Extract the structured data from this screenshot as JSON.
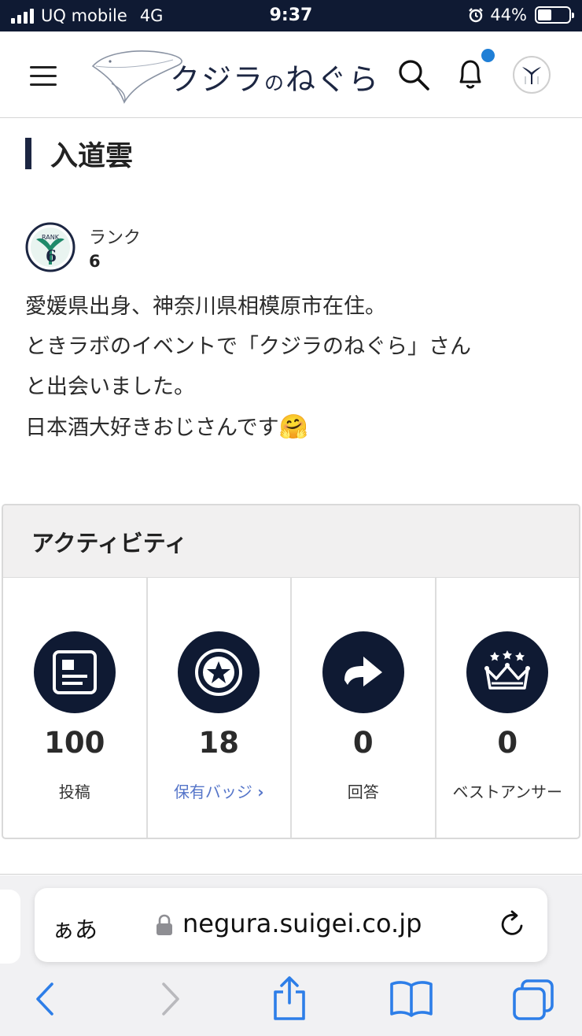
{
  "status_bar": {
    "carrier": "UQ mobile",
    "network": "4G",
    "time": "9:37",
    "battery": "44%",
    "battery_level": 0.44
  },
  "header": {
    "logo_text_main": "クジラ",
    "logo_text_particle": "の",
    "logo_text_tail": "ねぐら",
    "icons": [
      "menu-icon",
      "search-icon",
      "bell-icon",
      "avatar"
    ]
  },
  "profile": {
    "name": "入道雲",
    "rank_label": "ランク",
    "rank_value": "6",
    "rank_badge_text": "RANK",
    "bio_lines": [
      "愛媛県出身、神奈川県相模原市在住。",
      "ときラボのイベントで「クジラのねぐら」さん",
      "と出会いました。",
      "日本酒大好きおじさんです"
    ],
    "bio_emoji": "🤗"
  },
  "activity": {
    "title": "アクティビティ",
    "items": [
      {
        "value": "100",
        "label": "投稿",
        "icon": "post-icon"
      },
      {
        "value": "18",
        "label": "保有バッジ",
        "icon": "badge-star-icon",
        "link": true
      },
      {
        "value": "0",
        "label": "回答",
        "icon": "answer-arrow-icon"
      },
      {
        "value": "0",
        "label": "ベストアンサー",
        "icon": "crown-icon"
      }
    ]
  },
  "browser": {
    "aa_label": "ぁあ",
    "url": "negura.suigei.co.jp",
    "link_chevron": "›"
  },
  "colors": {
    "navy": "#0f1a33",
    "link": "#5575c9",
    "ios_blue": "#2d7ee8",
    "notification": "#1f7fd6"
  }
}
